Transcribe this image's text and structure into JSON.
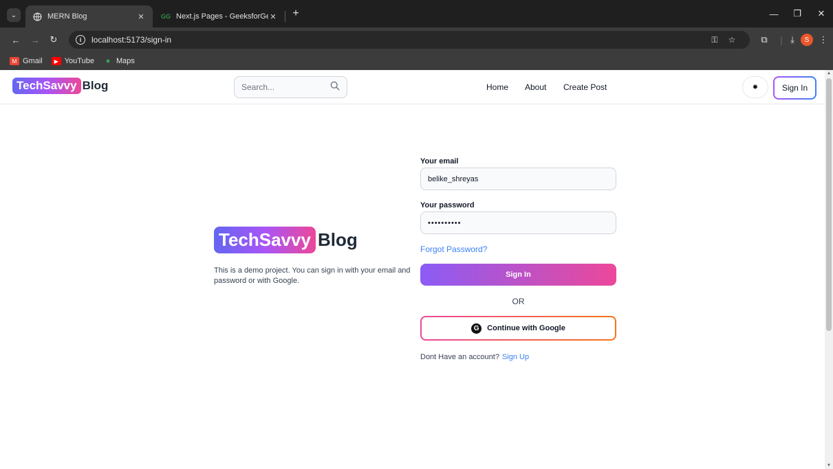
{
  "browser": {
    "tabs": [
      {
        "title": "MERN Blog",
        "active": true
      },
      {
        "title": "Next.js Pages - GeeksforGeeks",
        "active": false
      }
    ],
    "url": "localhost:5173/sign-in",
    "profile_initial": "S",
    "bookmarks": [
      {
        "label": "Gmail",
        "icon": "gmail-icon"
      },
      {
        "label": "YouTube",
        "icon": "youtube-icon"
      },
      {
        "label": "Maps",
        "icon": "maps-icon"
      }
    ]
  },
  "header": {
    "logo_highlight": "TechSavvy",
    "logo_rest": "Blog",
    "search_placeholder": "Search...",
    "nav": [
      "Home",
      "About",
      "Create Post"
    ],
    "signin_label": "Sign In"
  },
  "left": {
    "logo_highlight": "TechSavvy",
    "logo_rest": "Blog",
    "description": "This is a demo project. You can sign in with your email and password or with Google."
  },
  "form": {
    "email_label": "Your email",
    "email_value": "belike_shreyas",
    "password_label": "Your password",
    "password_value": "••••••••••",
    "forgot": "Forgot Password?",
    "signin_button": "Sign In",
    "or": "OR",
    "google_button": "Continue with Google",
    "no_account": "Dont Have an account?",
    "signup": "Sign Up"
  },
  "colors": {
    "accent_purple": "#8b5cf6",
    "accent_pink": "#ec4899",
    "link_blue": "#3b82f6"
  }
}
